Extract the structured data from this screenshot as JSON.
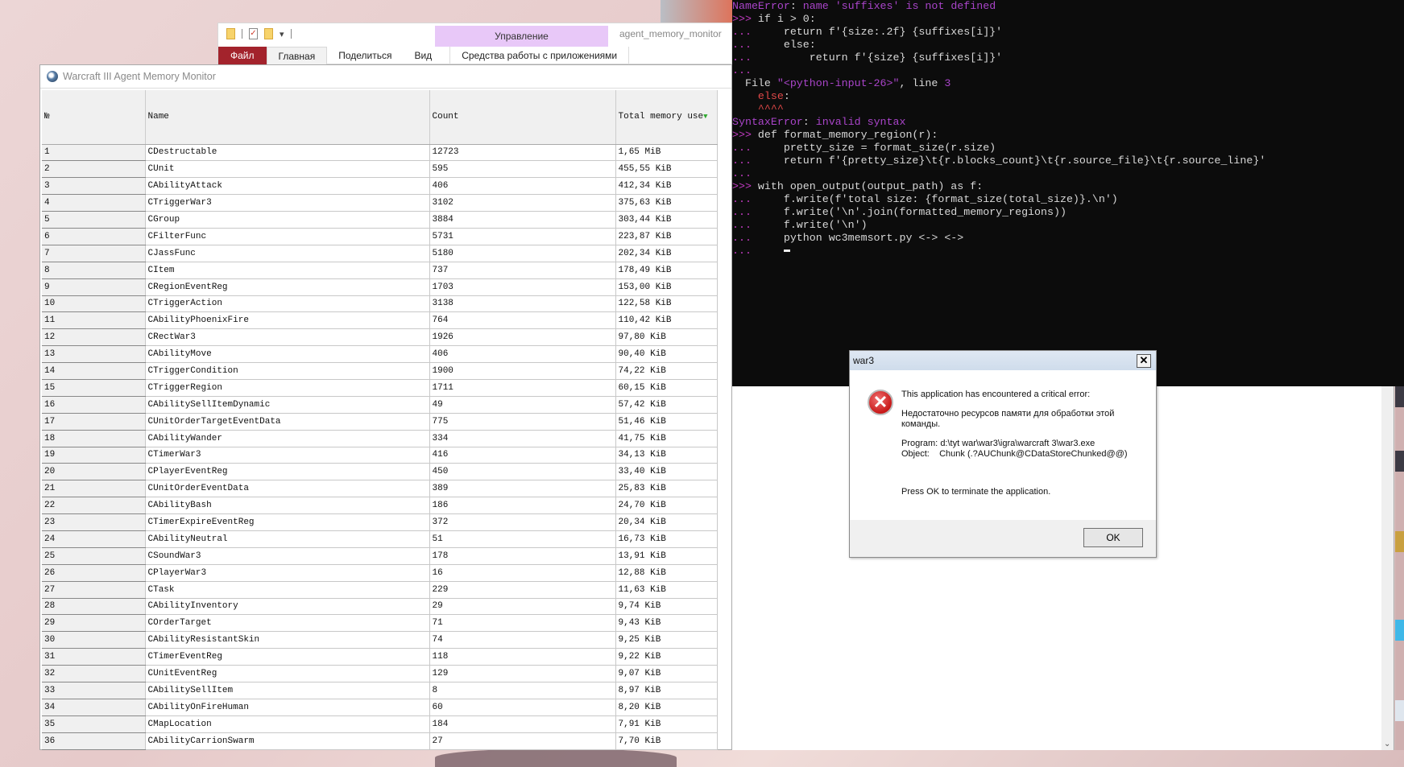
{
  "explorer": {
    "manage_tab": "Управление",
    "app_title": "agent_memory_monitor",
    "tabs": [
      "Файл",
      "Главная",
      "Поделиться",
      "Вид",
      "Средства работы с приложениями"
    ]
  },
  "monitor": {
    "title": "Warcraft III Agent Memory Monitor",
    "columns": [
      "№",
      "Name",
      "Count",
      "Total memory use"
    ],
    "sort_indicator": "▼",
    "rows": [
      [
        "1",
        "CDestructable",
        "12723",
        "1,65 MiB"
      ],
      [
        "2",
        "CUnit",
        "595",
        "455,55 KiB"
      ],
      [
        "3",
        "CAbilityAttack",
        "406",
        "412,34 KiB"
      ],
      [
        "4",
        "CTriggerWar3",
        "3102",
        "375,63 KiB"
      ],
      [
        "5",
        "CGroup",
        "3884",
        "303,44 KiB"
      ],
      [
        "6",
        "CFilterFunc",
        "5731",
        "223,87 KiB"
      ],
      [
        "7",
        "CJassFunc",
        "5180",
        "202,34 KiB"
      ],
      [
        "8",
        "CItem",
        "737",
        "178,49 KiB"
      ],
      [
        "9",
        "CRegionEventReg",
        "1703",
        "153,00 KiB"
      ],
      [
        "10",
        "CTriggerAction",
        "3138",
        "122,58 KiB"
      ],
      [
        "11",
        "CAbilityPhoenixFire",
        "764",
        "110,42 KiB"
      ],
      [
        "12",
        "CRectWar3",
        "1926",
        "97,80 KiB"
      ],
      [
        "13",
        "CAbilityMove",
        "406",
        "90,40 KiB"
      ],
      [
        "14",
        "CTriggerCondition",
        "1900",
        "74,22 KiB"
      ],
      [
        "15",
        "CTriggerRegion",
        "1711",
        "60,15 KiB"
      ],
      [
        "16",
        "CAbilitySellItemDynamic",
        "49",
        "57,42 KiB"
      ],
      [
        "17",
        "CUnitOrderTargetEventData",
        "775",
        "51,46 KiB"
      ],
      [
        "18",
        "CAbilityWander",
        "334",
        "41,75 KiB"
      ],
      [
        "19",
        "CTimerWar3",
        "416",
        "34,13 KiB"
      ],
      [
        "20",
        "CPlayerEventReg",
        "450",
        "33,40 KiB"
      ],
      [
        "21",
        "CUnitOrderEventData",
        "389",
        "25,83 KiB"
      ],
      [
        "22",
        "CAbilityBash",
        "186",
        "24,70 KiB"
      ],
      [
        "23",
        "CTimerExpireEventReg",
        "372",
        "20,34 KiB"
      ],
      [
        "24",
        "CAbilityNeutral",
        "51",
        "16,73 KiB"
      ],
      [
        "25",
        "CSoundWar3",
        "178",
        "13,91 KiB"
      ],
      [
        "26",
        "CPlayerWar3",
        "16",
        "12,88 KiB"
      ],
      [
        "27",
        "CTask",
        "229",
        "11,63 KiB"
      ],
      [
        "28",
        "CAbilityInventory",
        "29",
        "9,74 KiB"
      ],
      [
        "29",
        "COrderTarget",
        "71",
        "9,43 KiB"
      ],
      [
        "30",
        "CAbilityResistantSkin",
        "74",
        "9,25 KiB"
      ],
      [
        "31",
        "CTimerEventReg",
        "118",
        "9,22 KiB"
      ],
      [
        "32",
        "CUnitEventReg",
        "129",
        "9,07 KiB"
      ],
      [
        "33",
        "CAbilitySellItem",
        "8",
        "8,97 KiB"
      ],
      [
        "34",
        "CAbilityOnFireHuman",
        "60",
        "8,20 KiB"
      ],
      [
        "35",
        "CMapLocation",
        "184",
        "7,91 KiB"
      ],
      [
        "36",
        "CAbilityCarrionSwarm",
        "27",
        "7,70 KiB"
      ]
    ]
  },
  "terminal": {
    "lines": [
      [
        [
          "e",
          "NameError"
        ],
        [
          "t",
          ": "
        ],
        [
          "e",
          "name 'suffixes' is not defined"
        ]
      ],
      [
        [
          "p",
          ">>> "
        ],
        [
          "t",
          "if i > 0:"
        ]
      ],
      [
        [
          "p",
          "...     "
        ],
        [
          "t",
          "return f'{size:.2f} {suffixes[i]}'"
        ]
      ],
      [
        [
          "p",
          "...     "
        ],
        [
          "t",
          "else:"
        ]
      ],
      [
        [
          "p",
          "...         "
        ],
        [
          "t",
          "return f'{size} {suffixes[i]}'"
        ]
      ],
      [
        [
          "p",
          "..."
        ]
      ],
      [
        [
          "t",
          "  File "
        ],
        [
          "e",
          "\"<python-input-26>\""
        ],
        [
          "t",
          ", line "
        ],
        [
          "e",
          "3"
        ]
      ],
      [
        [
          "r",
          "    else"
        ],
        [
          "t",
          ":"
        ]
      ],
      [
        [
          "r",
          "    ^^^^"
        ]
      ],
      [
        [
          "e",
          "SyntaxError"
        ],
        [
          "t",
          ": "
        ],
        [
          "e",
          "invalid syntax"
        ]
      ],
      [
        [
          "p",
          ">>> "
        ],
        [
          "t",
          "def format_memory_region(r):"
        ]
      ],
      [
        [
          "p",
          "...     "
        ],
        [
          "t",
          "pretty_size = format_size(r.size)"
        ]
      ],
      [
        [
          "p",
          "...     "
        ],
        [
          "t",
          "return f'{pretty_size}\\t{r.blocks_count}\\t{r.source_file}\\t{r.source_line}'"
        ]
      ],
      [
        [
          "p",
          "..."
        ]
      ],
      [
        [
          "p",
          ">>> "
        ],
        [
          "t",
          "with open_output(output_path) as f:"
        ]
      ],
      [
        [
          "p",
          "...     "
        ],
        [
          "t",
          "f.write(f'total size: {format_size(total_size)}.\\n')"
        ]
      ],
      [
        [
          "p",
          "...     "
        ],
        [
          "t",
          "f.write('\\n'.join(formatted_memory_regions))"
        ]
      ],
      [
        [
          "p",
          "...     "
        ],
        [
          "t",
          "f.write('\\n')"
        ]
      ],
      [
        [
          "p",
          "...     "
        ],
        [
          "t",
          "python wc3memsort.py <-> <->"
        ]
      ],
      [
        [
          "p",
          "...     "
        ]
      ]
    ]
  },
  "dialog": {
    "title": "war3",
    "close": "✕",
    "line1": "This application has encountered a critical error:",
    "line2": "Недостаточно ресурсов памяти для обработки этой команды.",
    "program_label": "Program:",
    "program": "d:\\tyt war\\war3\\igra\\warcraft 3\\war3.exe",
    "object_label": "Object:",
    "object": "Chunk (.?AUChunk@CDataStoreChunked@@)",
    "line4": "Press OK to terminate the application.",
    "ok": "OK"
  },
  "colors": {
    "file_tab": "#a3232c",
    "manage_tab": "#e8c8f8",
    "terminal_bg": "#0c0c0c",
    "prompt": "#c23bc2",
    "error": "#a944c9"
  }
}
